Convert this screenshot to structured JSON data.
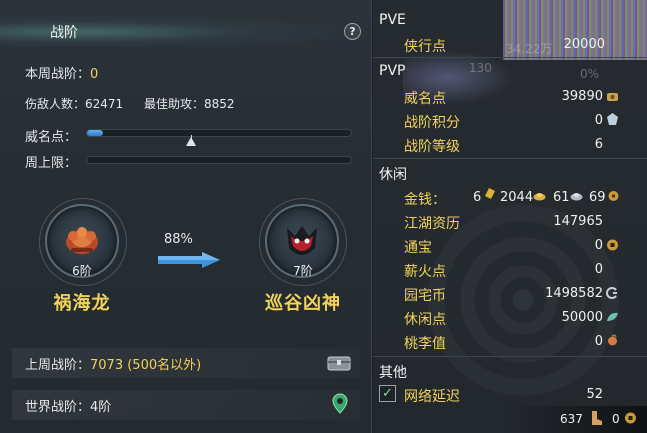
{
  "left": {
    "title": "战阶",
    "help": "?",
    "this_week_label": "本周战阶：",
    "this_week_value": "0",
    "kills_label": "伤敌人数：",
    "kills_value": "62471",
    "best_assist_label": "最佳助攻：",
    "best_assist_value": "8852",
    "prestige_label": "威名点：",
    "prestige_progress": 0.06,
    "weekly_cap_label": "周上限：",
    "weekly_cap_progress": 0,
    "current_rank": {
      "level": "6阶",
      "name": "祸海龙"
    },
    "next_rank": {
      "level": "7阶",
      "name": "巡谷凶神"
    },
    "progress_percent": "88%",
    "last_week_label": "上周战阶：",
    "last_week_value": "7073 (500名以外)",
    "world_label": "世界战阶：",
    "world_value": "4阶"
  },
  "right": {
    "pve_title": "PVE",
    "pve_rows": [
      {
        "name": "侠行点",
        "value": "20000"
      }
    ],
    "pvp_title": "PVP",
    "pvp_rows": [
      {
        "name": "威名点",
        "value": "39890"
      },
      {
        "name": "战阶积分",
        "value": "0"
      },
      {
        "name": "战阶等级",
        "value": "6"
      }
    ],
    "leisure_title": "休闲",
    "money": {
      "name": "金钱：",
      "gold": "6",
      "silver": "2044",
      "copper": "61",
      "other": "69"
    },
    "leisure_rows": [
      {
        "name": "江湖资历",
        "value": "147965"
      },
      {
        "name": "通宝",
        "value": "0"
      },
      {
        "name": "薪火点",
        "value": "0"
      },
      {
        "name": "园宅币",
        "value": "1498582"
      },
      {
        "name": "休闲点",
        "value": "50000"
      },
      {
        "name": "桃李值",
        "value": "0"
      }
    ],
    "other_title": "其他",
    "other_rows": [
      {
        "name": "网络延迟",
        "value": "52"
      }
    ],
    "background_text": {
      "a": "34.22万",
      "b": "130",
      "c": "0%"
    },
    "bottom_bar": {
      "left_value": "637",
      "right_value": "0"
    }
  },
  "colors": {
    "accent_yellow": "#f2d35a",
    "bar_blue": "#3f93dc"
  }
}
